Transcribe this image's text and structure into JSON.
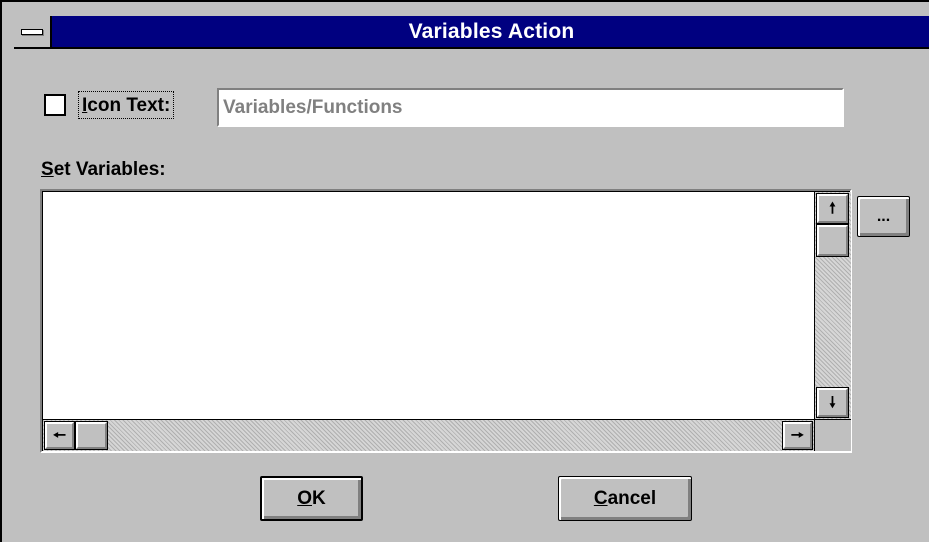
{
  "window": {
    "title": "Variables Action"
  },
  "icon_text": {
    "checked": false,
    "label_prefix": "I",
    "label_rest": "con Text:",
    "value": "Variables/Functions"
  },
  "set_variables": {
    "label_prefix": "S",
    "label_rest": "et Variables:",
    "items": []
  },
  "buttons": {
    "browse_label": "...",
    "ok_prefix": "O",
    "ok_rest": "K",
    "cancel_prefix": "C",
    "cancel_rest": "ancel"
  },
  "icons": {
    "system_menu": "system-menu-icon",
    "scroll_up": "arrow-up-icon",
    "scroll_down": "arrow-down-icon",
    "scroll_left": "arrow-left-icon",
    "scroll_right": "arrow-right-icon"
  },
  "colors": {
    "titlebar": "#000080",
    "face": "#c0c0c0",
    "disabled_text": "#808080"
  }
}
